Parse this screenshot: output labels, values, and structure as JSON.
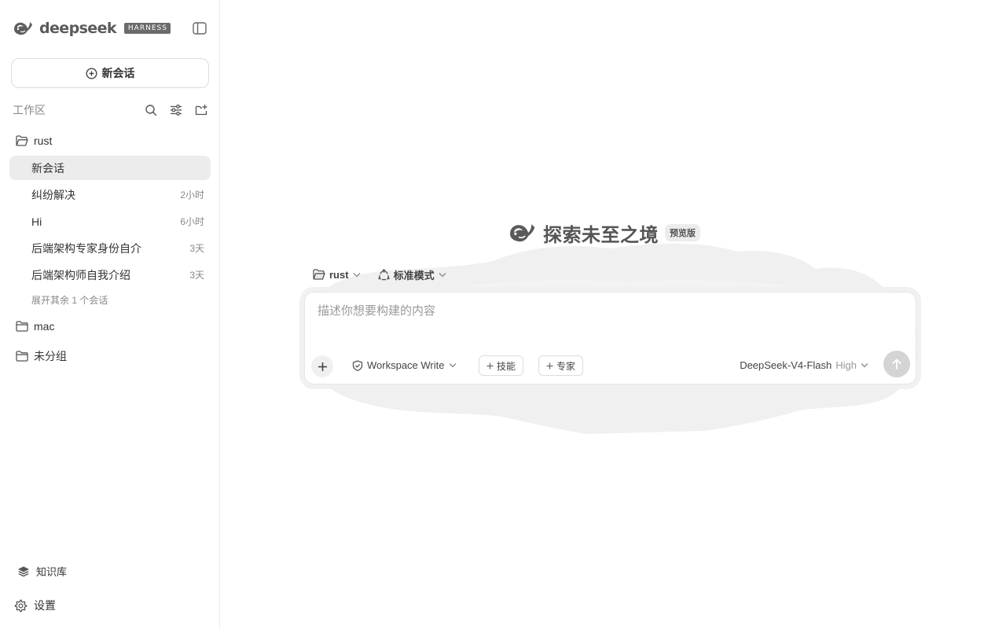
{
  "brand": {
    "name": "deepseek",
    "badge": "HARNESS"
  },
  "sidebar": {
    "new_chat_label": "新会话",
    "workspace_title": "工作区",
    "folders": [
      {
        "name": "rust",
        "sessions": [
          {
            "title": "新会话",
            "time": "",
            "active": true
          },
          {
            "title": "纠纷解决",
            "time": "2小时"
          },
          {
            "title": "Hi",
            "time": "6小时"
          },
          {
            "title": "后端架构专家身份自介",
            "time": "3天"
          },
          {
            "title": "后端架构师自我介绍",
            "time": "3天"
          }
        ],
        "expand_more": "展开其余 1 个会话"
      },
      {
        "name": "mac"
      },
      {
        "name": "未分组"
      }
    ],
    "knowledge_label": "知识库",
    "settings_label": "设置"
  },
  "main": {
    "hero_title": "探索未至之境",
    "hero_badge": "预览版",
    "workspace_selector": "rust",
    "mode_selector": "标准模式",
    "composer": {
      "placeholder": "描述你想要构建的内容",
      "permission": "Workspace Write",
      "skill_chip": "技能",
      "expert_chip": "专家",
      "model": "DeepSeek-V4-Flash",
      "model_level": "High"
    }
  },
  "icons": {
    "brand": "whale-logo-icon",
    "collapse": "sidebar-toggle-icon",
    "new_chat": "plus-circle-icon",
    "search": "search-icon",
    "filter": "sliders-icon",
    "new_folder": "folder-plus-icon",
    "folder_open": "folder-open-icon",
    "folder": "folder-icon",
    "knowledge": "stack-icon",
    "settings": "gear-icon",
    "mode": "recycle-icon",
    "permission": "shield-check-icon",
    "attach": "plus-icon",
    "send": "arrow-up-icon"
  },
  "colors": {
    "accent_gray": "#d4d4d4",
    "active_bg": "#ececec",
    "cloud": "#f0f0f0"
  }
}
